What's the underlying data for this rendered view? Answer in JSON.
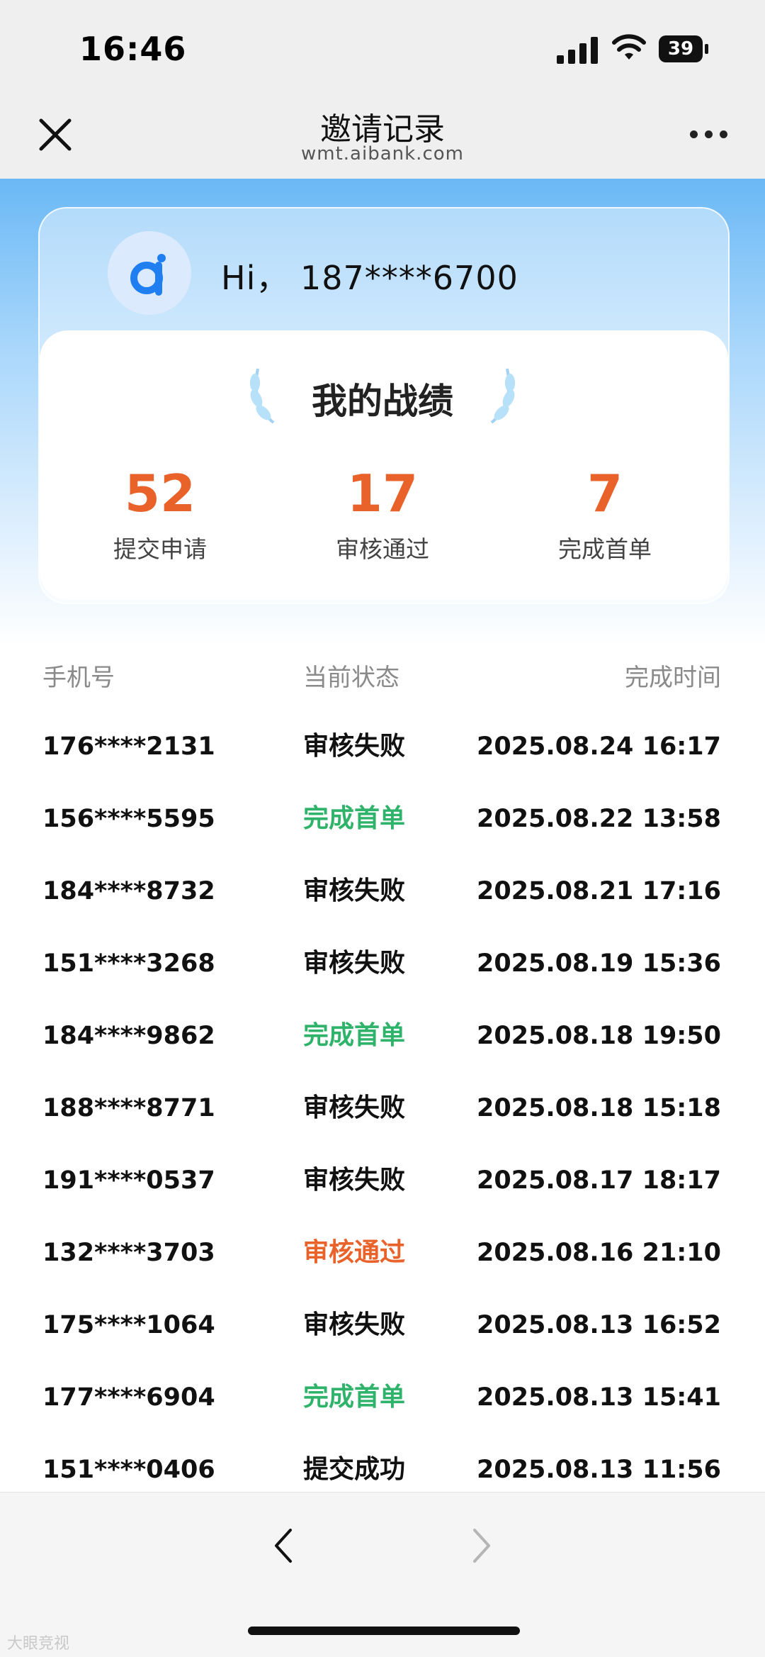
{
  "status_bar": {
    "time": "16:46",
    "battery": "39"
  },
  "nav": {
    "title": "邀请记录",
    "subtitle": "wmt.aibank.com"
  },
  "user": {
    "greeting": "Hi，  187****6700"
  },
  "stats": {
    "title": "我的战绩",
    "items": [
      {
        "value": "52",
        "label": "提交申请"
      },
      {
        "value": "17",
        "label": "审核通过"
      },
      {
        "value": "7",
        "label": "完成首单"
      }
    ]
  },
  "table": {
    "headers": {
      "phone": "手机号",
      "status": "当前状态",
      "time": "完成时间"
    },
    "status_colors": {
      "审核失败": "#111111",
      "完成首单": "#2fb36a",
      "审核通过": "#e8622a",
      "提交成功": "#111111"
    },
    "rows": [
      {
        "phone": "176****2131",
        "status": "审核失败",
        "time": "2025.08.24 16:17"
      },
      {
        "phone": "156****5595",
        "status": "完成首单",
        "time": "2025.08.22 13:58"
      },
      {
        "phone": "184****8732",
        "status": "审核失败",
        "time": "2025.08.21 17:16"
      },
      {
        "phone": "151****3268",
        "status": "审核失败",
        "time": "2025.08.19 15:36"
      },
      {
        "phone": "184****9862",
        "status": "完成首单",
        "time": "2025.08.18 19:50"
      },
      {
        "phone": "188****8771",
        "status": "审核失败",
        "time": "2025.08.18 15:18"
      },
      {
        "phone": "191****0537",
        "status": "审核失败",
        "time": "2025.08.17 18:17"
      },
      {
        "phone": "132****3703",
        "status": "审核通过",
        "time": "2025.08.16 21:10"
      },
      {
        "phone": "175****1064",
        "status": "审核失败",
        "time": "2025.08.13 16:52"
      },
      {
        "phone": "177****6904",
        "status": "完成首单",
        "time": "2025.08.13 15:41"
      },
      {
        "phone": "151****0406",
        "status": "提交成功",
        "time": "2025.08.13 11:56"
      }
    ]
  },
  "colors": {
    "accent": "#e8622a",
    "success": "#2fb36a",
    "hero": "#6ab8f5"
  },
  "watermark": "大眼竞视"
}
